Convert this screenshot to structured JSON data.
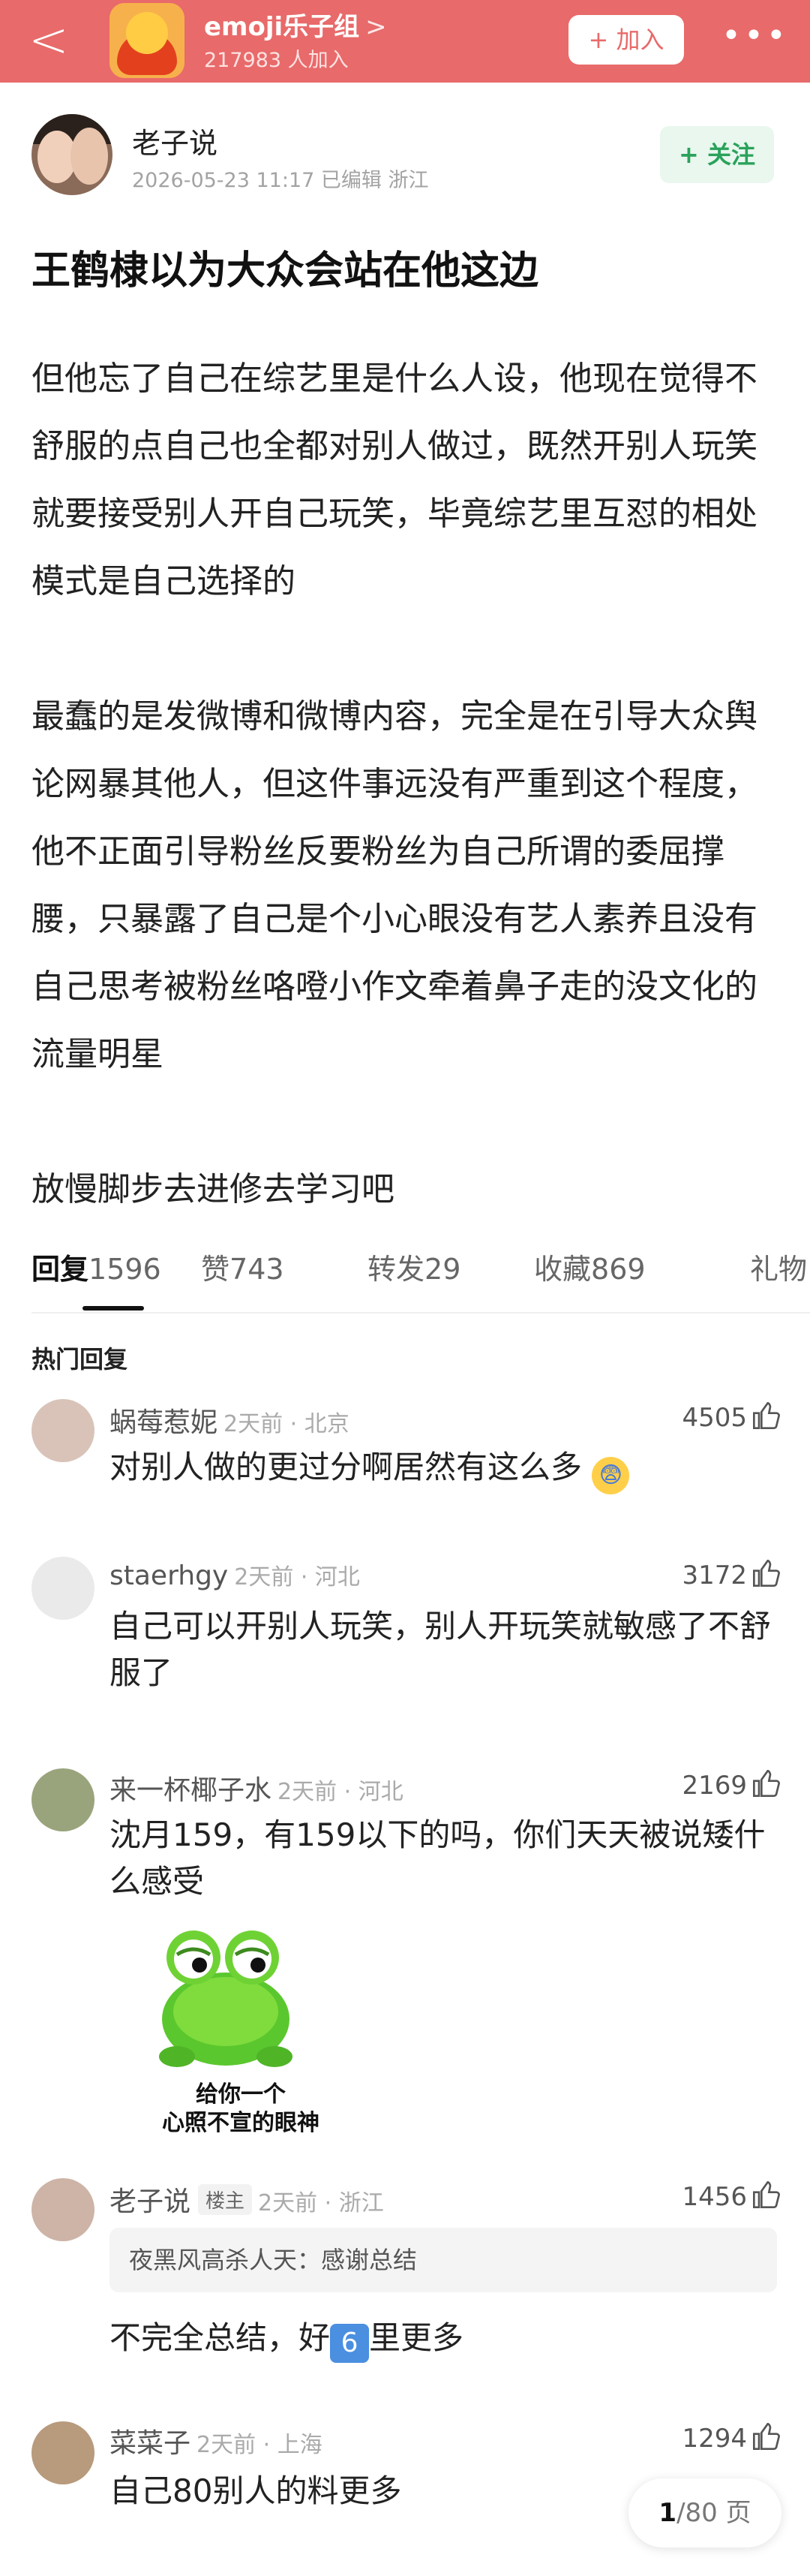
{
  "header": {
    "group_name": "emoji乐子组",
    "group_chevron": ">",
    "members": "217983 人加入",
    "join_label": "+ 加入",
    "back_glyph": "<",
    "more_glyph": "•••",
    "accent": "#e86a6a"
  },
  "post": {
    "author": "老子说",
    "meta": "2026-05-23 11:17  已编辑  浙江",
    "follow_label": "+ 关注",
    "title": "王鹤棣以为大众会站在他这边",
    "paragraphs": [
      "但他忘了自己在综艺里是什么人设，他现在觉得不舒服的点自己也全都对别人做过，既然开别人玩笑就要接受别人开自己玩笑，毕竟综艺里互怼的相处模式是自己选择的",
      "最蠢的是发微博和微博内容，完全是在引导大众舆论网暴其他人，但这件事远没有严重到这个程度，他不正面引导粉丝反要粉丝为自己所谓的委屈撑腰，只暴露了自己是个小心眼没有艺人素养且没有自己思考被粉丝咯噔小作文牵着鼻子走的没文化的流量明星",
      "放慢脚步去进修去学习吧"
    ]
  },
  "tabs": [
    {
      "label": "回复",
      "count": "1596"
    },
    {
      "label": "赞",
      "count": "743"
    },
    {
      "label": "转发",
      "count": "29"
    },
    {
      "label": "收藏",
      "count": "869"
    },
    {
      "label": "礼物",
      "count": ""
    }
  ],
  "hot_replies_label": "热门回复",
  "comments": [
    {
      "name": "蜗莓惹妮",
      "meta": "2天前 · 北京",
      "likes": "4505",
      "text": "对别人做的更过分啊居然有这么多",
      "emoji": "scared-face"
    },
    {
      "name": "staerhgy",
      "meta": "2天前 · 河北",
      "likes": "3172",
      "text": "自己可以开别人玩笑，别人开玩笑就敏感了不舒服了"
    },
    {
      "name": "来一杯椰子水",
      "meta": "2天前 · 河北",
      "likes": "2169",
      "text": "沈月159，有159以下的吗，你们天天被说矮什么感受",
      "sticker_caption_1": "给你一个",
      "sticker_caption_2": "心照不宣的眼神"
    },
    {
      "name": "老子说",
      "badge": "楼主",
      "meta": "2天前 · 浙江",
      "likes": "1456",
      "quote": "夜黑风高杀人天：感谢总结",
      "text": "不完全总结，好",
      "text_tail": "里更多",
      "keycap": "6"
    },
    {
      "name": "菜菜子",
      "meta": "2天前 · 上海",
      "likes": "1294",
      "text": "自己80别人的料更多"
    }
  ],
  "pager": {
    "current": "1",
    "total": "/80 页"
  }
}
